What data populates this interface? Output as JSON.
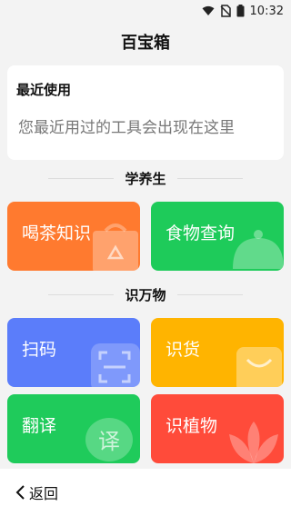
{
  "status_bar": {
    "time": "10:32",
    "icons": [
      "wifi-icon",
      "no-sim-icon",
      "battery-icon"
    ]
  },
  "app_title": "百宝箱",
  "recent": {
    "heading": "最近使用",
    "empty_text": "您最近用过的工具会出现在这里"
  },
  "sections": [
    {
      "title": "学养生",
      "tiles": [
        {
          "label": "喝茶知识",
          "color": "#ff7a2f",
          "icon": "recycle-bag-icon"
        },
        {
          "label": "食物查询",
          "color": "#1ecb5a",
          "icon": "food-cloche-icon"
        }
      ]
    },
    {
      "title": "识万物",
      "tiles": [
        {
          "label": "扫码",
          "color": "#5b7dfa",
          "icon": "scan-frame-icon"
        },
        {
          "label": "识货",
          "color": "#ffb400",
          "icon": "shopping-bag-icon"
        },
        {
          "label": "翻译",
          "color": "#1fcb5b",
          "icon": "translate-bubble-icon"
        },
        {
          "label": "识植物",
          "color": "#ff4b3a",
          "icon": "lotus-icon"
        }
      ]
    }
  ],
  "bottom": {
    "back_label": "返回"
  },
  "colors": {
    "background": "#f3f3f3",
    "card": "#ffffff",
    "muted_text": "#777777"
  }
}
